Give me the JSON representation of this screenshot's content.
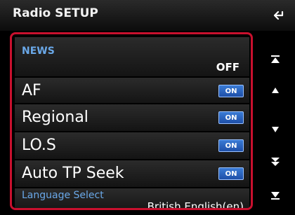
{
  "header": {
    "title": "Radio SETUP"
  },
  "icons": {
    "back": "back-arrow-icon",
    "first": "scroll-top-icon",
    "up": "scroll-up-icon",
    "down": "scroll-down-icon",
    "page_down": "page-down-icon",
    "last": "scroll-bottom-icon"
  },
  "settings": {
    "news": {
      "label": "NEWS",
      "value": "OFF"
    },
    "af": {
      "label": "AF",
      "state": "ON"
    },
    "regional": {
      "label": "Regional",
      "state": "ON"
    },
    "los": {
      "label": "LO.S",
      "state": "ON"
    },
    "auto_tp": {
      "label": "Auto TP Seek",
      "state": "ON"
    },
    "language": {
      "label": "Language Select",
      "value": "British English(en)"
    }
  },
  "colors": {
    "accent_border": "#c8102e",
    "label_blue": "#6aa8e8",
    "toggle_on": "#2f6cc4"
  }
}
